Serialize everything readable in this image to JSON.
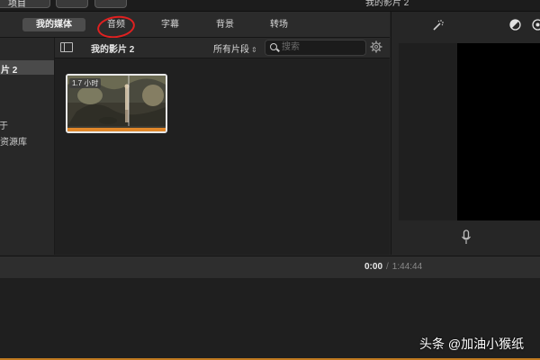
{
  "toolbar": {
    "back_label": "项目",
    "project_title": "我的影片 2"
  },
  "tabs": [
    {
      "label": "我的媒体",
      "selected": true
    },
    {
      "label": "音频",
      "selected": false,
      "annotated": "red-circle"
    },
    {
      "label": "字幕",
      "selected": false
    },
    {
      "label": "背景",
      "selected": false
    },
    {
      "label": "转场",
      "selected": false
    }
  ],
  "sidebar": {
    "selected_item": "片 2",
    "fragment_item": "于",
    "library_item": "资源库"
  },
  "browser": {
    "title": "我的影片 2",
    "clip_filter": "所有片段",
    "search_placeholder": "搜索",
    "clip": {
      "duration_badge": "1.7 小时"
    }
  },
  "timeline": {
    "current_time": "0:00",
    "separator": "/",
    "total_time": "1:44:44"
  },
  "watermark": "头条 @加油小猴纸",
  "icons": {
    "magic_wand": "magic-wand-icon",
    "color_balance": "color-balance-icon",
    "color_correction": "color-correction-icon",
    "microphone": "microphone-icon",
    "gear": "gear-icon",
    "search": "search-icon"
  },
  "colors": {
    "accent_orange": "#e0872a",
    "annotation_red": "#e02020",
    "viewer_black": "#000000"
  }
}
